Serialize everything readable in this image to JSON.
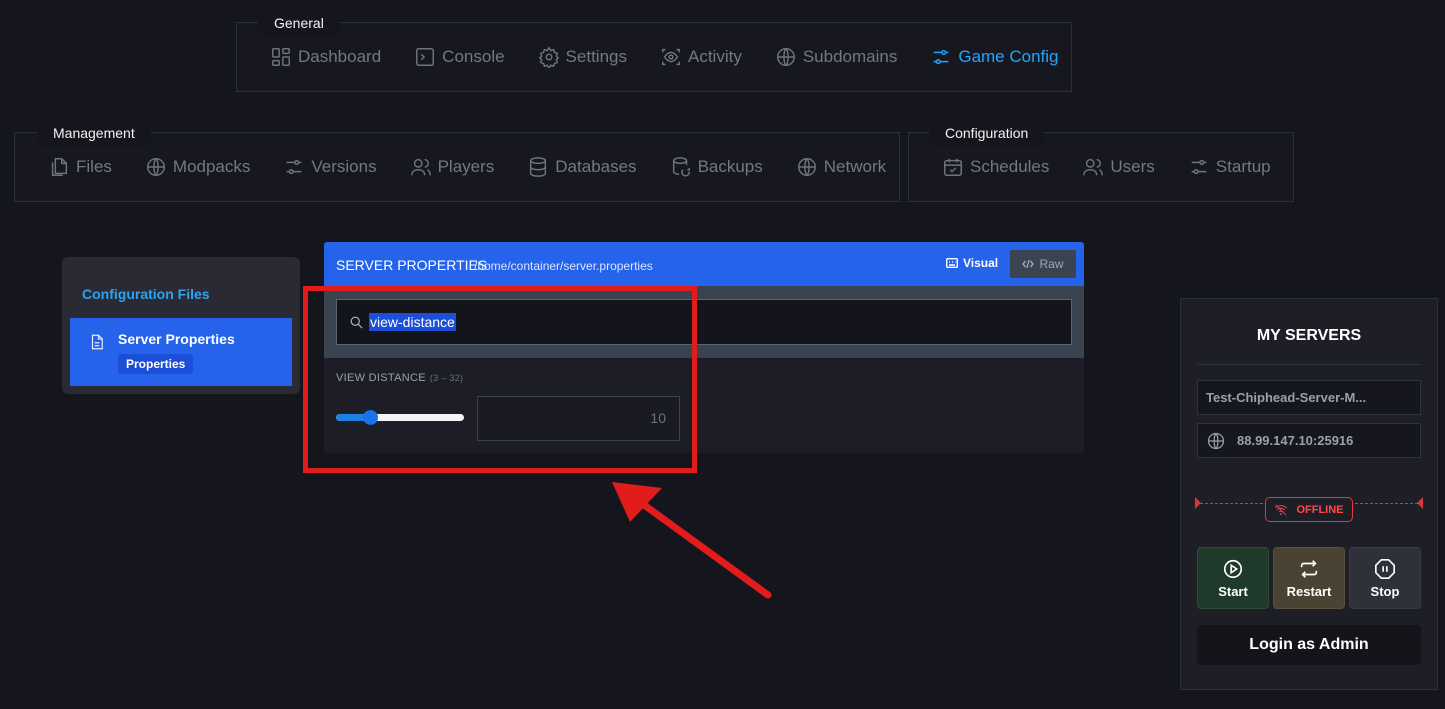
{
  "nav": {
    "general": {
      "label": "General",
      "items": [
        {
          "label": "Dashboard",
          "icon": "dashboard-icon"
        },
        {
          "label": "Console",
          "icon": "terminal-icon"
        },
        {
          "label": "Settings",
          "icon": "gear-icon"
        },
        {
          "label": "Activity",
          "icon": "eye-icon"
        },
        {
          "label": "Subdomains",
          "icon": "globe-icon"
        },
        {
          "label": "Game Config",
          "icon": "sliders-icon",
          "active": true
        }
      ]
    },
    "management": {
      "label": "Management",
      "items": [
        {
          "label": "Files",
          "icon": "files-icon"
        },
        {
          "label": "Modpacks",
          "icon": "globe-icon"
        },
        {
          "label": "Versions",
          "icon": "sliders-icon"
        },
        {
          "label": "Players",
          "icon": "users-icon"
        },
        {
          "label": "Databases",
          "icon": "database-icon"
        },
        {
          "label": "Backups",
          "icon": "backup-icon"
        },
        {
          "label": "Network",
          "icon": "globe-icon"
        }
      ]
    },
    "configuration": {
      "label": "Configuration",
      "items": [
        {
          "label": "Schedules",
          "icon": "calendar-icon"
        },
        {
          "label": "Users",
          "icon": "users-icon"
        },
        {
          "label": "Startup",
          "icon": "sliders-icon"
        }
      ]
    }
  },
  "config_files": {
    "title": "Configuration Files",
    "file": {
      "name": "Server Properties",
      "badge": "Properties"
    }
  },
  "panel": {
    "title": "SERVER PROPERTIES",
    "path": "/home/container/server.properties",
    "visual_label": "Visual",
    "raw_label": "Raw",
    "search_value": "view-distance",
    "property": {
      "label": "VIEW DISTANCE",
      "range": "(3 – 32)",
      "min": 3,
      "max": 32,
      "value": "10"
    }
  },
  "my_servers": {
    "title": "MY SERVERS",
    "server_name": "Test-Chiphead-Server-M...",
    "address": "88.99.147.10:25916",
    "status": "OFFLINE",
    "start_label": "Start",
    "restart_label": "Restart",
    "stop_label": "Stop",
    "login_label": "Login as Admin"
  },
  "colors": {
    "accent": "#2563eb",
    "active_nav": "#1ea7ff",
    "offline": "#ff4a4a",
    "annotation": "#e21b1b"
  }
}
